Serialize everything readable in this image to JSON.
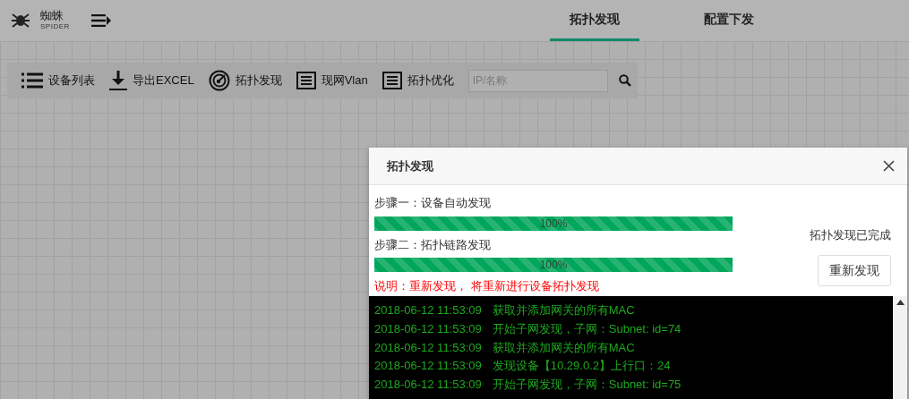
{
  "header": {
    "logo_title": "蜘蛛",
    "logo_subtitle": "SPIDER",
    "tabs": [
      {
        "label": "拓扑发现",
        "selected": true
      },
      {
        "label": "配置下发",
        "selected": false
      }
    ]
  },
  "toolbar": {
    "items": [
      {
        "label": "设备列表",
        "kind": "list"
      },
      {
        "label": "导出EXCEL",
        "kind": "download"
      },
      {
        "label": "拓扑发现",
        "kind": "radar"
      },
      {
        "label": "现网Vlan",
        "kind": "panel"
      },
      {
        "label": "拓扑优化",
        "kind": "panel"
      }
    ],
    "search": {
      "placeholder": "IP/名称"
    }
  },
  "dialog": {
    "title": "拓扑发现",
    "steps": [
      {
        "label": "步骤一：设备自动发现",
        "level": 1,
        "reading": "100%"
      },
      {
        "label": "步骤二：拓扑链路发现",
        "level": 1,
        "reading": "100%"
      }
    ],
    "status": "拓扑发现已完成",
    "button": "重新发现",
    "note": "说明：重新发现， 将重新进行设备拓扑发现",
    "log": [
      {
        "time": "2018-06-12 11:53:09",
        "message": "获取并添加网关的所有MAC"
      },
      {
        "time": "2018-06-12 11:53:09",
        "message": "开始子网发现，子网：Subnet: id=74"
      },
      {
        "time": "2018-06-12 11:53:09",
        "message": "获取并添加网关的所有MAC"
      },
      {
        "time": "2018-06-12 11:53:09",
        "message": "发现设备【10.29.0.2】上行口：24"
      },
      {
        "time": "2018-06-12 11:53:09",
        "message": "开始子网发现，子网：Subnet: id=75"
      }
    ]
  }
}
